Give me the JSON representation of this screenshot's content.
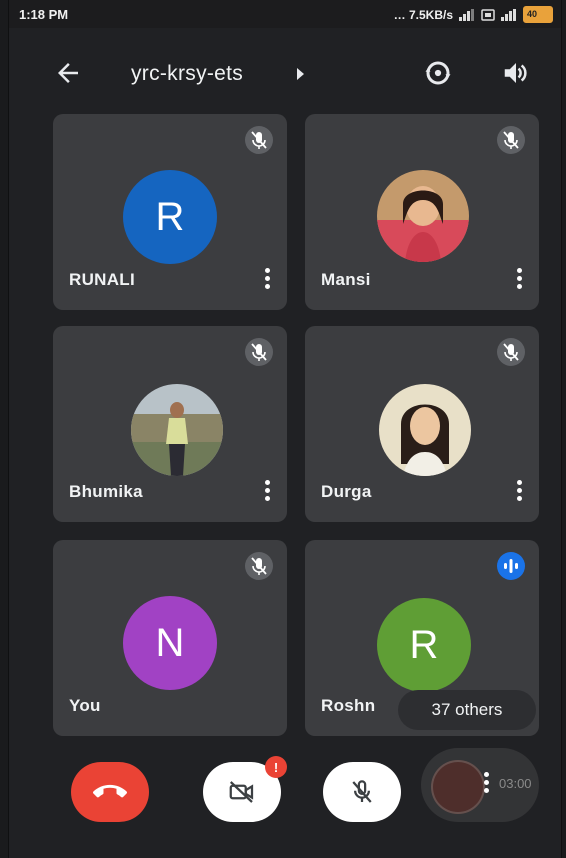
{
  "status_bar": {
    "time": "1:18 PM",
    "speed": "… 7.5KB/s",
    "battery": "40"
  },
  "header": {
    "meeting_code": "yrc-krsy-ets",
    "back_icon": "arrow-back-icon",
    "switch_camera_icon": "switch-camera-icon",
    "speaker_icon": "speaker-icon"
  },
  "participants": [
    {
      "name": "RUNALI",
      "initial": "R",
      "avatar_color": "#1565c0",
      "muted": true
    },
    {
      "name": "Mansi",
      "initial": "",
      "avatar_color": "",
      "muted": true
    },
    {
      "name": "Bhumika",
      "initial": "",
      "avatar_color": "",
      "muted": true
    },
    {
      "name": "Durga",
      "initial": "",
      "avatar_color": "",
      "muted": true
    },
    {
      "name": "You",
      "initial": "N",
      "avatar_color": "#a142c4",
      "muted": true
    },
    {
      "name": "Roshn",
      "initial": "R",
      "avatar_color": "#5f9e35",
      "muted": false,
      "speaking": true
    }
  ],
  "others_label": "37 others",
  "controls": {
    "end_call_color": "#ea4335",
    "camera_badge": "!",
    "recording_time": "03:00"
  }
}
